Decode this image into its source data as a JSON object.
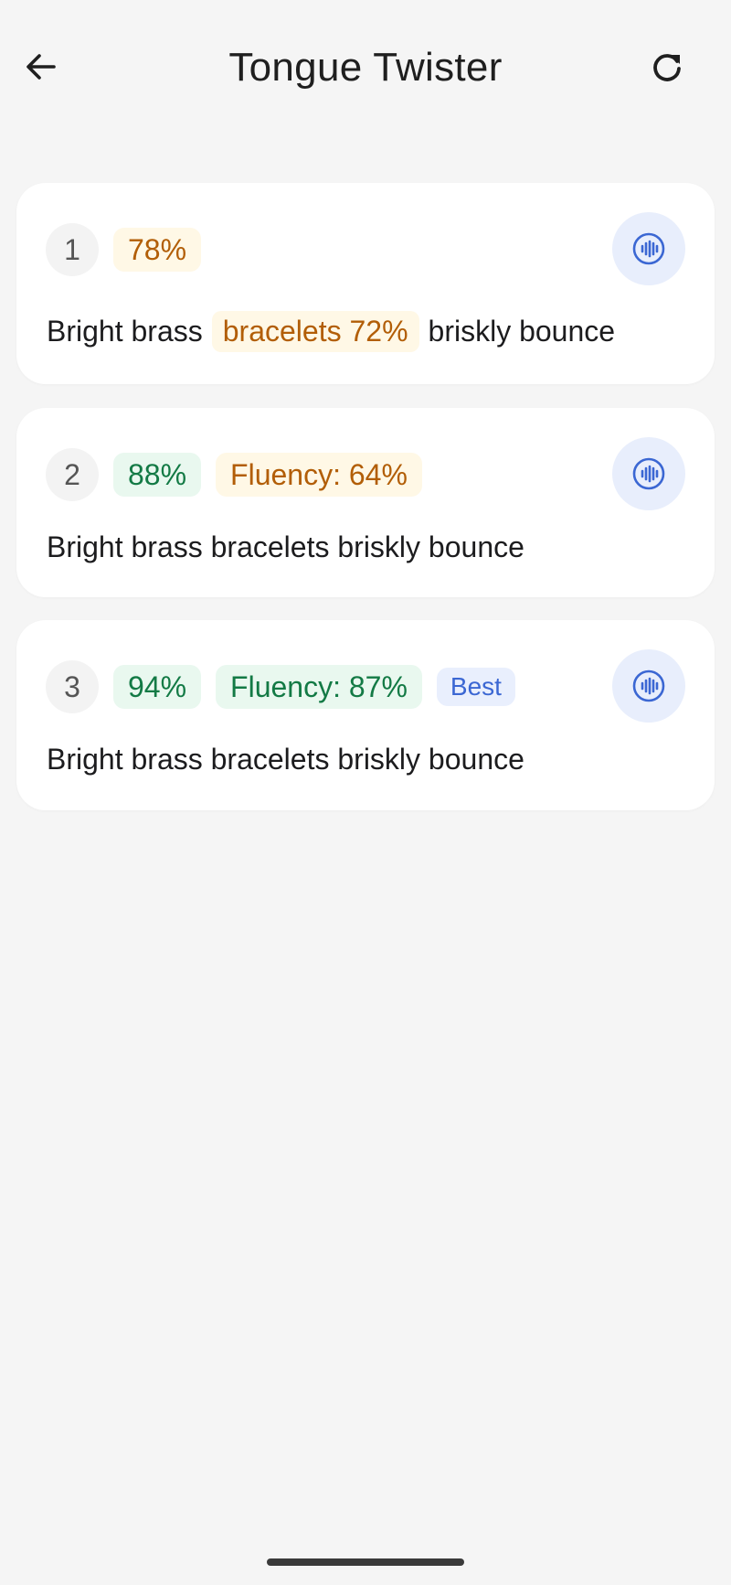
{
  "header": {
    "title": "Tongue Twister",
    "back_icon": "arrow-left-icon",
    "refresh_icon": "refresh-icon"
  },
  "attempts": [
    {
      "number": "1",
      "score": "78%",
      "score_status": "warning",
      "sentence_before": "Bright brass",
      "sentence_highlight": "bracelets 72%",
      "sentence_after": "briskly bounce"
    },
    {
      "number": "2",
      "score": "88%",
      "score_status": "good",
      "fluency": "Fluency: 64%",
      "fluency_status": "warning",
      "sentence": "Bright brass bracelets briskly bounce"
    },
    {
      "number": "3",
      "score": "94%",
      "score_status": "good",
      "fluency": "Fluency: 87%",
      "fluency_status": "good",
      "badge": "Best",
      "sentence": "Bright brass bracelets briskly bounce"
    }
  ],
  "colors": {
    "background": "#f5f5f5",
    "warning_text": "#b25e07",
    "warning_bg": "#fff8e6",
    "good_text": "#137a45",
    "good_bg": "#e9f8ef",
    "accent": "#3b67d3",
    "accent_bg": "#e8eefc"
  }
}
